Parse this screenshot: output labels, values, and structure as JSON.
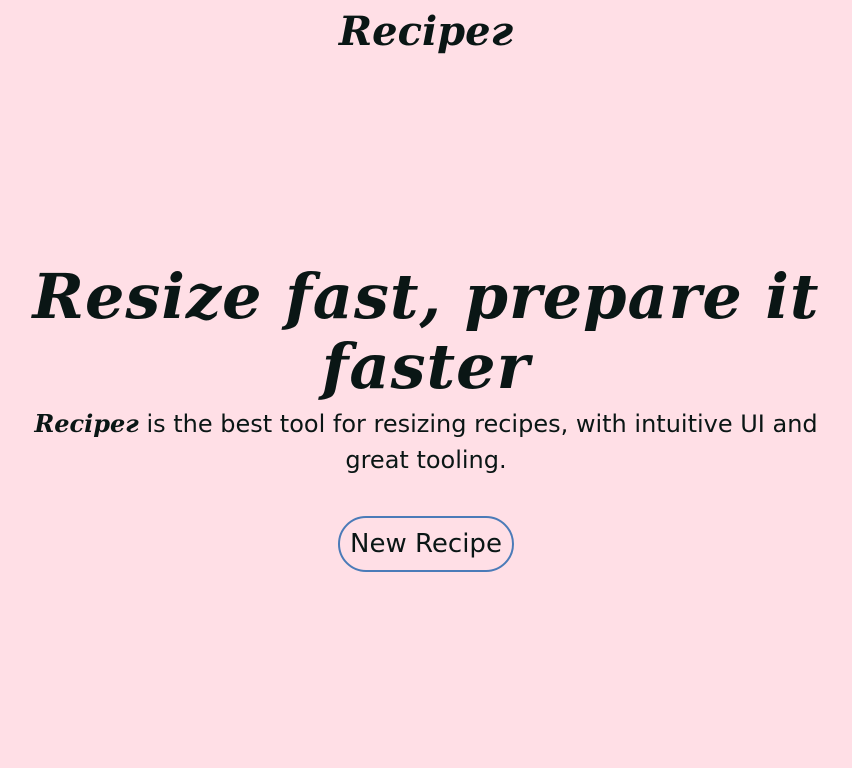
{
  "header": {
    "brand": "Recipeг"
  },
  "hero": {
    "headline": "Resize fast, prepare it faster",
    "tagline_brand": "Recipeг",
    "tagline_text": " is the best tool for resizing recipes, with intuitive UI and great tooling.",
    "button_label": "New Recipe"
  },
  "colors": {
    "background": "#ffdfe6",
    "text": "#0a1615",
    "button_border": "#4b7bb8"
  }
}
